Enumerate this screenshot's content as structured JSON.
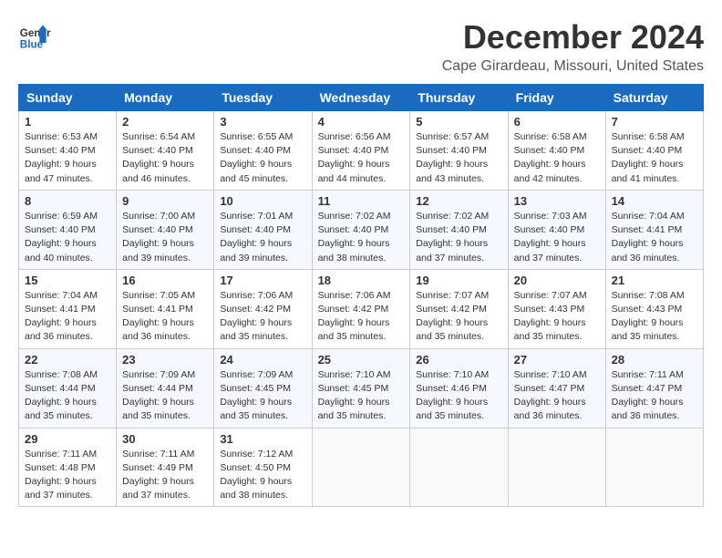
{
  "header": {
    "logo_line1": "General",
    "logo_line2": "Blue",
    "month": "December 2024",
    "location": "Cape Girardeau, Missouri, United States"
  },
  "weekdays": [
    "Sunday",
    "Monday",
    "Tuesday",
    "Wednesday",
    "Thursday",
    "Friday",
    "Saturday"
  ],
  "weeks": [
    [
      {
        "day": "1",
        "sunrise": "6:53 AM",
        "sunset": "4:40 PM",
        "daylight": "9 hours and 47 minutes."
      },
      {
        "day": "2",
        "sunrise": "6:54 AM",
        "sunset": "4:40 PM",
        "daylight": "9 hours and 46 minutes."
      },
      {
        "day": "3",
        "sunrise": "6:55 AM",
        "sunset": "4:40 PM",
        "daylight": "9 hours and 45 minutes."
      },
      {
        "day": "4",
        "sunrise": "6:56 AM",
        "sunset": "4:40 PM",
        "daylight": "9 hours and 44 minutes."
      },
      {
        "day": "5",
        "sunrise": "6:57 AM",
        "sunset": "4:40 PM",
        "daylight": "9 hours and 43 minutes."
      },
      {
        "day": "6",
        "sunrise": "6:58 AM",
        "sunset": "4:40 PM",
        "daylight": "9 hours and 42 minutes."
      },
      {
        "day": "7",
        "sunrise": "6:58 AM",
        "sunset": "4:40 PM",
        "daylight": "9 hours and 41 minutes."
      }
    ],
    [
      {
        "day": "8",
        "sunrise": "6:59 AM",
        "sunset": "4:40 PM",
        "daylight": "9 hours and 40 minutes."
      },
      {
        "day": "9",
        "sunrise": "7:00 AM",
        "sunset": "4:40 PM",
        "daylight": "9 hours and 39 minutes."
      },
      {
        "day": "10",
        "sunrise": "7:01 AM",
        "sunset": "4:40 PM",
        "daylight": "9 hours and 39 minutes."
      },
      {
        "day": "11",
        "sunrise": "7:02 AM",
        "sunset": "4:40 PM",
        "daylight": "9 hours and 38 minutes."
      },
      {
        "day": "12",
        "sunrise": "7:02 AM",
        "sunset": "4:40 PM",
        "daylight": "9 hours and 37 minutes."
      },
      {
        "day": "13",
        "sunrise": "7:03 AM",
        "sunset": "4:40 PM",
        "daylight": "9 hours and 37 minutes."
      },
      {
        "day": "14",
        "sunrise": "7:04 AM",
        "sunset": "4:41 PM",
        "daylight": "9 hours and 36 minutes."
      }
    ],
    [
      {
        "day": "15",
        "sunrise": "7:04 AM",
        "sunset": "4:41 PM",
        "daylight": "9 hours and 36 minutes."
      },
      {
        "day": "16",
        "sunrise": "7:05 AM",
        "sunset": "4:41 PM",
        "daylight": "9 hours and 36 minutes."
      },
      {
        "day": "17",
        "sunrise": "7:06 AM",
        "sunset": "4:42 PM",
        "daylight": "9 hours and 35 minutes."
      },
      {
        "day": "18",
        "sunrise": "7:06 AM",
        "sunset": "4:42 PM",
        "daylight": "9 hours and 35 minutes."
      },
      {
        "day": "19",
        "sunrise": "7:07 AM",
        "sunset": "4:42 PM",
        "daylight": "9 hours and 35 minutes."
      },
      {
        "day": "20",
        "sunrise": "7:07 AM",
        "sunset": "4:43 PM",
        "daylight": "9 hours and 35 minutes."
      },
      {
        "day": "21",
        "sunrise": "7:08 AM",
        "sunset": "4:43 PM",
        "daylight": "9 hours and 35 minutes."
      }
    ],
    [
      {
        "day": "22",
        "sunrise": "7:08 AM",
        "sunset": "4:44 PM",
        "daylight": "9 hours and 35 minutes."
      },
      {
        "day": "23",
        "sunrise": "7:09 AM",
        "sunset": "4:44 PM",
        "daylight": "9 hours and 35 minutes."
      },
      {
        "day": "24",
        "sunrise": "7:09 AM",
        "sunset": "4:45 PM",
        "daylight": "9 hours and 35 minutes."
      },
      {
        "day": "25",
        "sunrise": "7:10 AM",
        "sunset": "4:45 PM",
        "daylight": "9 hours and 35 minutes."
      },
      {
        "day": "26",
        "sunrise": "7:10 AM",
        "sunset": "4:46 PM",
        "daylight": "9 hours and 35 minutes."
      },
      {
        "day": "27",
        "sunrise": "7:10 AM",
        "sunset": "4:47 PM",
        "daylight": "9 hours and 36 minutes."
      },
      {
        "day": "28",
        "sunrise": "7:11 AM",
        "sunset": "4:47 PM",
        "daylight": "9 hours and 36 minutes."
      }
    ],
    [
      {
        "day": "29",
        "sunrise": "7:11 AM",
        "sunset": "4:48 PM",
        "daylight": "9 hours and 37 minutes."
      },
      {
        "day": "30",
        "sunrise": "7:11 AM",
        "sunset": "4:49 PM",
        "daylight": "9 hours and 37 minutes."
      },
      {
        "day": "31",
        "sunrise": "7:12 AM",
        "sunset": "4:50 PM",
        "daylight": "9 hours and 38 minutes."
      },
      null,
      null,
      null,
      null
    ]
  ]
}
